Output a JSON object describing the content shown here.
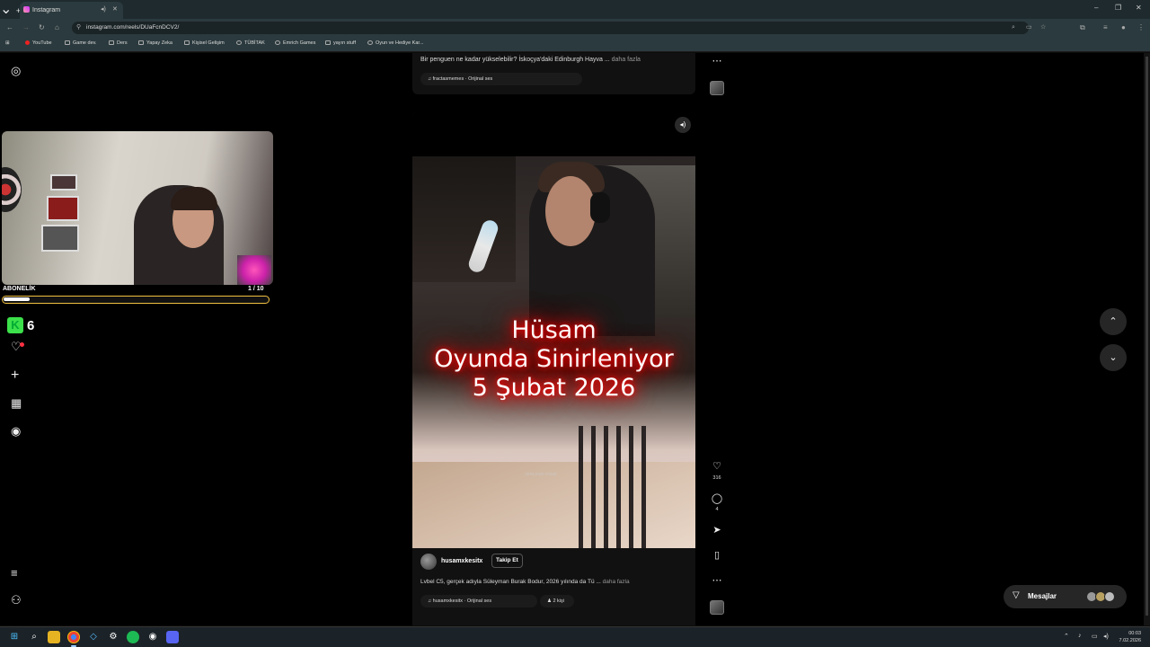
{
  "browser": {
    "tab_title": "Instagram",
    "url": "instagram.com/reels/DUaFcnDCV2/",
    "bookmarks": [
      "YouTube",
      "Game dev.",
      "Ders",
      "Yapay Zeka",
      "Kişisel Gelişim",
      "TÜBİTAK",
      "Emrich Games",
      "yayın stuff",
      "Oyun ve Hediye Kar..."
    ]
  },
  "overlay": {
    "subscription_label": "ABONELİK",
    "subscription_count": "1 / 10",
    "subscription_progress": 0.1,
    "kick_count": "6"
  },
  "reels": {
    "previous": {
      "caption": "Bir penguen ne kadar yükselebilir? İskoçya'daki Edinburgh Hayva ...",
      "more_label": "daha fazla",
      "audio": "fractasmemes · Orijinal ses"
    },
    "current": {
      "title_overlay_lines": [
        "Hüsam",
        "Oyunda Sinirleniyor",
        "5 Şubat 2026"
      ],
      "watermark": "VERLEŞİK FÜME",
      "username": "husamxkesitx",
      "follow_label": "Takip Et",
      "caption": "Lvbel C5, gerçek adıyla Süleyman Burak Bodur, 2026 yılında da Tü ...",
      "more_label": "daha fazla",
      "audio": "husamxkesitx · Orijinal ses",
      "people": "2 kişi",
      "likes": "316",
      "comments": "4"
    }
  },
  "messages": {
    "label": "Mesajlar"
  },
  "taskbar": {
    "time": "00:03",
    "date": "7.02.2026"
  },
  "colors": {
    "background": "#000000",
    "overlay_glow": "#ff0000",
    "subscription_border": "#f0c040",
    "kick_green": "#3ce04a"
  }
}
